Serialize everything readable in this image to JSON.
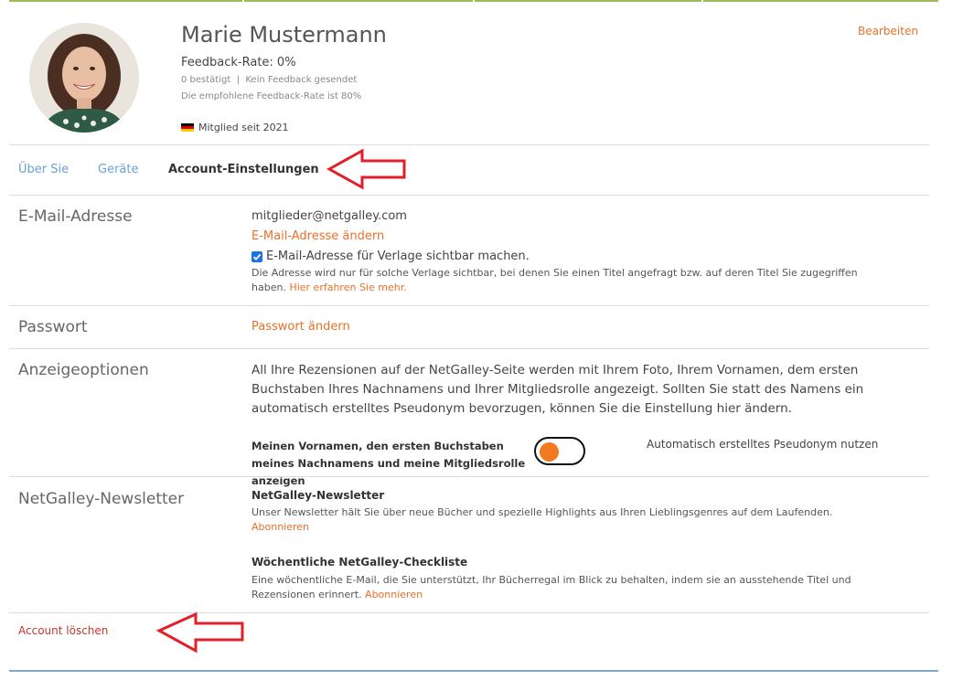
{
  "profile": {
    "name": "Marie Mustermann",
    "feedback_rate": "Feedback-Rate: 0%",
    "stats": "0 bestätigt  |  Kein Feedback gesendet",
    "recommended": "Die empfohlene Feedback-Rate ist 80%",
    "member_since": "Mitglied seit 2021",
    "flag_colors": [
      "#000000",
      "#dd0000",
      "#ffce00"
    ],
    "edit_label": "Bearbeiten"
  },
  "tabs": [
    {
      "label": "Über Sie",
      "active": false
    },
    {
      "label": "Geräte",
      "active": false
    },
    {
      "label": "Account-Einstellungen",
      "active": true
    }
  ],
  "email": {
    "title": "E-Mail-Adresse",
    "value": "mitglieder@netgalley.com",
    "change_link": "E-Mail-Adresse ändern",
    "checkbox_label": "E-Mail-Adresse für Verlage sichtbar machen.",
    "checkbox_checked": true,
    "note_line1": "Die Adresse wird nur für solche Verlage sichtbar, bei denen Sie einen Titel angefragt bzw. auf deren Titel Sie zugegriffen",
    "note_line2": "haben.",
    "learn_more": "Hier erfahren Sie mehr."
  },
  "password": {
    "title": "Passwort",
    "change_link": "Passwort ändern"
  },
  "display": {
    "title": "Anzeigeoptionen",
    "description": "All Ihre Rezensionen auf der NetGalley-Seite werden mit Ihrem Foto, Ihrem Vornamen, dem ersten Buchstaben Ihres Nachnamens und Ihrer Mitgliedsrolle angezeigt. Sollten Sie statt des Namens ein automatisch erstelltes Pseudonym bevorzugen, können Sie die Einstellung hier ändern.",
    "option_left": "Meinen Vornamen, den ersten Buchstaben meines Nachnamens und meine Mitgliedsrolle anzeigen",
    "option_right": "Automatisch erstelltes Pseudonym nutzen",
    "toggle_color": "#f07a1f"
  },
  "newsletter": {
    "title": "NetGalley-Newsletter",
    "items": [
      {
        "heading": "NetGalley-Newsletter",
        "desc1": "Unser Newsletter hält Sie über neue Bücher und spezielle Highlights aus Ihren Lieblingsgenres auf dem Laufenden.",
        "desc2": "",
        "link": "Abonnieren"
      },
      {
        "heading": "Wöchentliche NetGalley-Checkliste",
        "desc1": "Eine wöchentliche E-Mail, die Sie unterstützt, Ihr Bücherregal im Blick zu behalten, indem sie an ausstehende Titel und",
        "desc2": "Rezensionen erinnert.",
        "link": "Abonnieren"
      }
    ]
  },
  "account": {
    "delete_label": "Account löschen"
  },
  "colors": {
    "accent": "#e8702a",
    "tab_link": "#6a9fd4",
    "delete": "#c0392b",
    "annotation_arrow": "#e0202a"
  }
}
